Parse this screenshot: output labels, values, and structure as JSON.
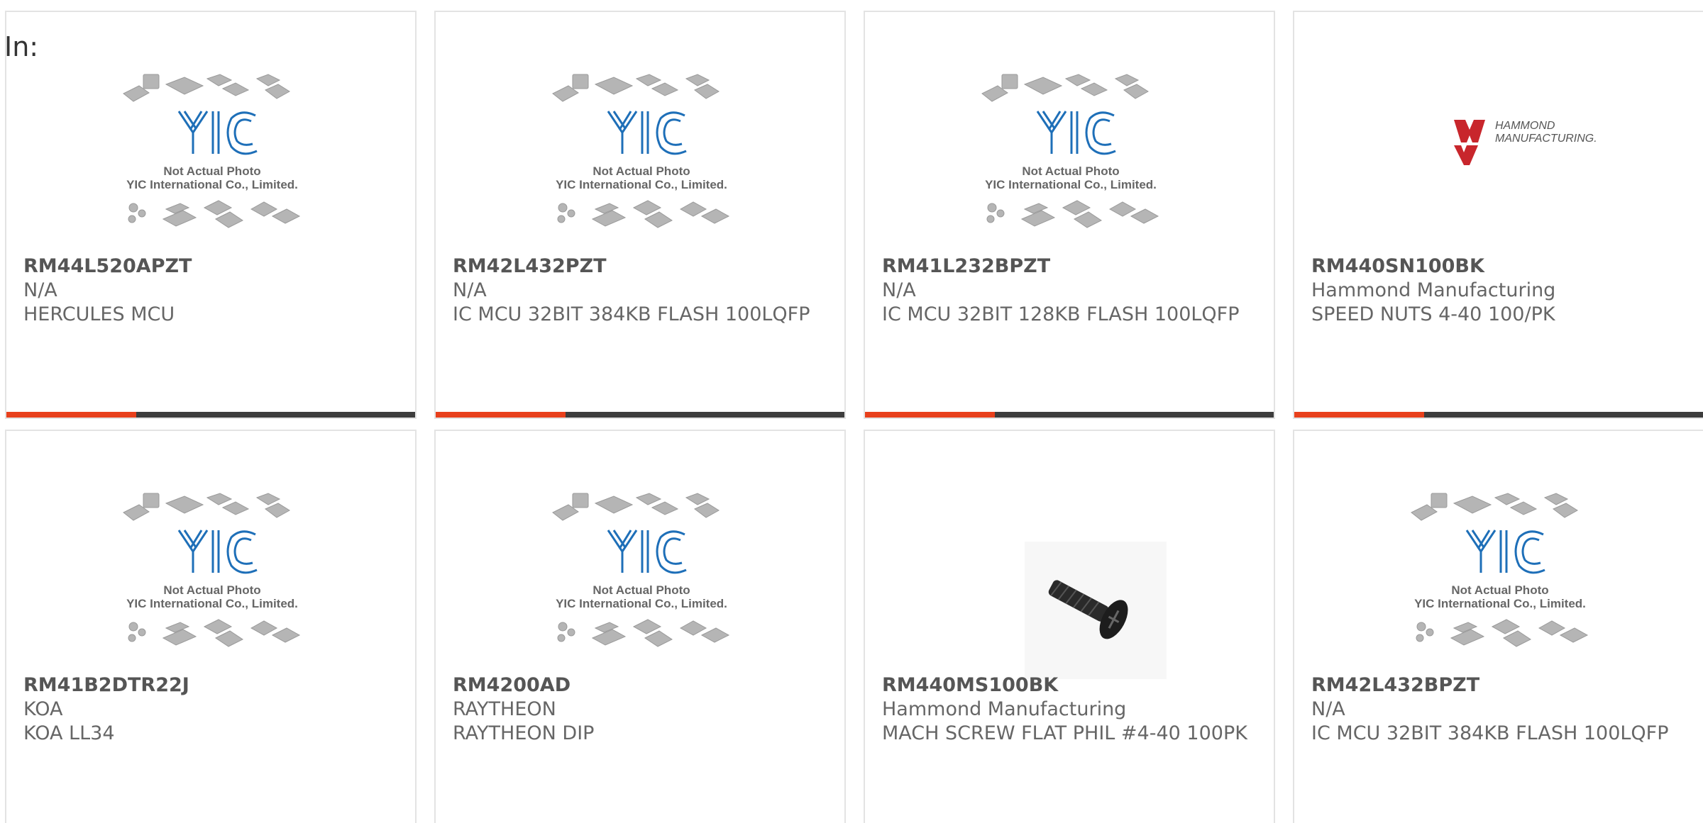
{
  "header": {
    "in_label": "In:"
  },
  "placeholder": {
    "logo_text": "YIC",
    "line1": "Not Actual Photo",
    "line2": "YIC International Co., Limited."
  },
  "hammond_logo": {
    "line1": "HAMMOND",
    "line2": "MANUFACTURING."
  },
  "colors": {
    "accent": "#e8401c",
    "bar": "#3d3d3d",
    "logo_blue": "#1e6fb8",
    "hammond_red": "#c8262c"
  },
  "products": [
    {
      "part": "RM44L520APZT",
      "manufacturer": "N/A",
      "description": "HERCULES MCU",
      "image": "yic-placeholder"
    },
    {
      "part": "RM42L432PZT",
      "manufacturer": "N/A",
      "description": "IC MCU 32BIT 384KB FLASH 100LQFP",
      "image": "yic-placeholder"
    },
    {
      "part": "RM41L232BPZT",
      "manufacturer": "N/A",
      "description": "IC MCU 32BIT 128KB FLASH 100LQFP",
      "image": "yic-placeholder"
    },
    {
      "part": "RM440SN100BK",
      "manufacturer": "Hammond Manufacturing",
      "description": "SPEED NUTS 4-40 100/PK",
      "image": "hammond-logo"
    },
    {
      "part": "RM41B2DTR22J",
      "manufacturer": "KOA",
      "description": "KOA LL34",
      "image": "yic-placeholder"
    },
    {
      "part": "RM4200AD",
      "manufacturer": "RAYTHEON",
      "description": "RAYTHEON DIP",
      "image": "yic-placeholder"
    },
    {
      "part": "RM440MS100BK",
      "manufacturer": "Hammond Manufacturing",
      "description": "MACH SCREW FLAT PHIL #4-40 100PK",
      "image": "screw-photo"
    },
    {
      "part": "RM42L432BPZT",
      "manufacturer": "N/A",
      "description": "IC MCU 32BIT 384KB FLASH 100LQFP",
      "image": "yic-placeholder"
    }
  ]
}
